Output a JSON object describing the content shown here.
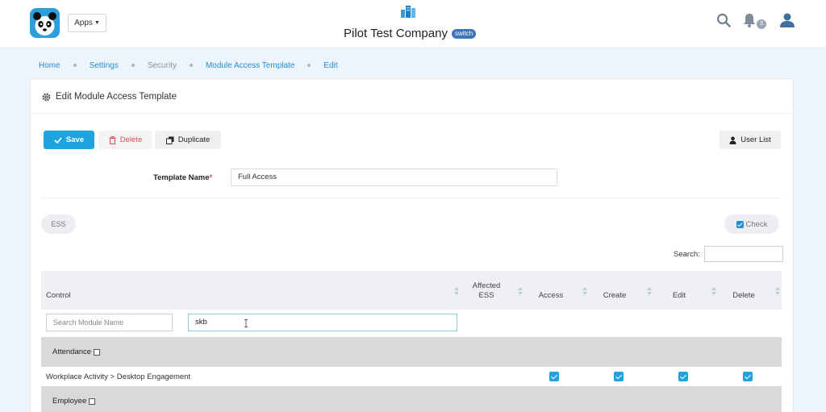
{
  "header": {
    "apps_label": "Apps",
    "company_name": "Pilot Test Company",
    "switch_label": "switch",
    "notification_count": "3",
    "brand_color": "#1ea4e0",
    "icons": [
      "panda-logo-icon",
      "building-icon",
      "search-icon",
      "bell-icon",
      "user-icon"
    ]
  },
  "breadcrumb": [
    "Home",
    "Settings",
    "Security",
    "Module Access Template",
    "Edit"
  ],
  "card": {
    "title": "Edit Module Access Template",
    "buttons": {
      "save": "Save",
      "delete": "Delete",
      "duplicate": "Duplicate",
      "user_list": "User List"
    },
    "template_name_label": "Template Name",
    "required_mark": "*",
    "template_name_value": "Full Access",
    "ess_label": "ESS",
    "check_label": "Check",
    "search_label": "Search:"
  },
  "table": {
    "headers": {
      "control": "Control",
      "affected_ess_line1": "Affected",
      "affected_ess_line2": "ESS",
      "access": "Access",
      "create": "Create",
      "edit": "Edit",
      "delete": "Delete"
    },
    "module_search_placeholder": "Search Module Name",
    "filter_value": "skb",
    "groups": [
      {
        "name": "Attendance",
        "checked": false
      },
      {
        "name": "Employee",
        "checked": false
      }
    ],
    "rows": [
      {
        "label": "Workplace Activity > Desktop Engagement",
        "access": true,
        "create": true,
        "edit": true,
        "delete": true
      }
    ]
  }
}
